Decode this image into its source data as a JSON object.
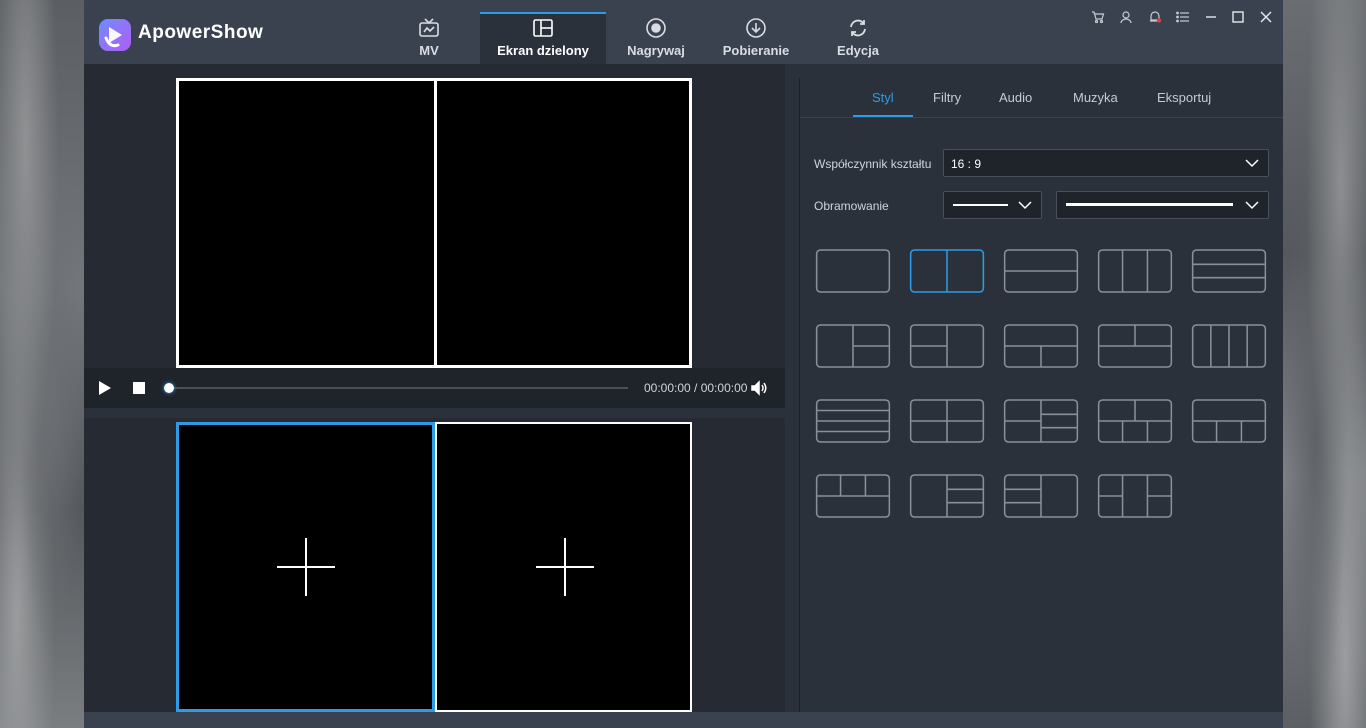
{
  "app": {
    "name": "ApowerShow"
  },
  "tabs": [
    {
      "label": "MV",
      "icon": "tv-icon",
      "active": false
    },
    {
      "label": "Ekran dzielony",
      "icon": "split-screen-icon",
      "active": true
    },
    {
      "label": "Nagrywaj",
      "icon": "record-icon",
      "active": false
    },
    {
      "label": "Pobieranie",
      "icon": "download-icon",
      "active": false
    },
    {
      "label": "Edycja",
      "icon": "refresh-icon",
      "active": false
    }
  ],
  "window_controls": [
    "cart-icon",
    "user-icon",
    "notification-icon",
    "menu-icon",
    "minimize-icon",
    "maximize-icon",
    "close-icon"
  ],
  "player": {
    "time": "00:00:00 / 00:00:00",
    "progress": 0
  },
  "right_tabs": [
    {
      "label": "Styl",
      "active": true
    },
    {
      "label": "Filtry",
      "active": false
    },
    {
      "label": "Audio",
      "active": false
    },
    {
      "label": "Muzyka",
      "active": false
    },
    {
      "label": "Eksportuj",
      "active": false
    }
  ],
  "style": {
    "aspect_label": "Współczynnik kształtu",
    "aspect_value": "16 : 9",
    "border_label": "Obramowanie"
  },
  "layouts_selected_index": 1,
  "colors": {
    "accent": "#2d9be6",
    "panel": "#2b313b",
    "titlebar": "#3a4250"
  }
}
